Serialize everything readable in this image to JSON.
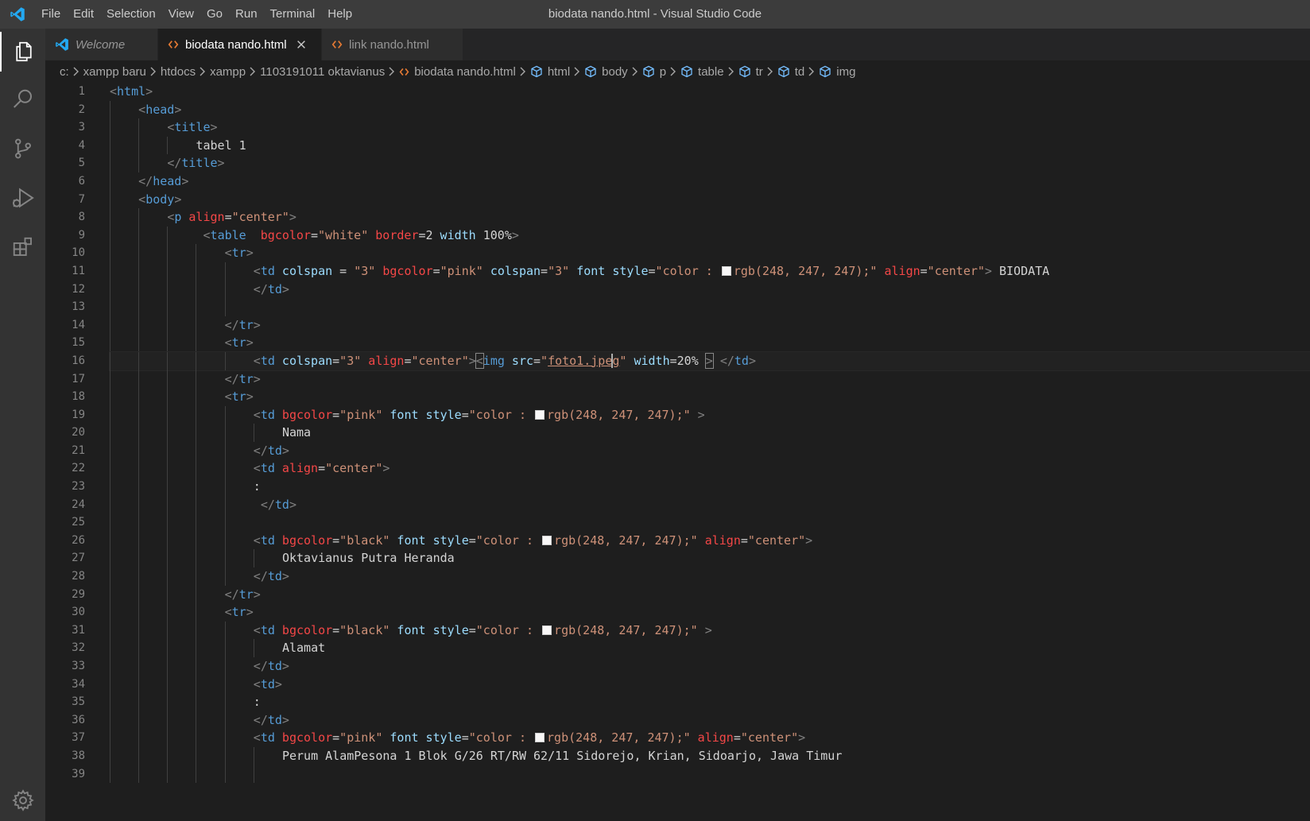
{
  "window": {
    "title": "biodata nando.html - Visual Studio Code",
    "menu": [
      "File",
      "Edit",
      "Selection",
      "View",
      "Go",
      "Run",
      "Terminal",
      "Help"
    ]
  },
  "activity_bar": {
    "items": [
      {
        "name": "explorer-icon",
        "active": true
      },
      {
        "name": "search-icon",
        "active": false
      },
      {
        "name": "source-control-icon",
        "active": false
      },
      {
        "name": "run-debug-icon",
        "active": false
      },
      {
        "name": "extensions-icon",
        "active": false
      }
    ],
    "bottom": {
      "name": "settings-gear-icon"
    }
  },
  "tabs": [
    {
      "label": "Welcome",
      "icon": "vscode-logo-icon",
      "active": false,
      "italic": true
    },
    {
      "label": "biodata nando.html",
      "icon": "html-file-icon",
      "active": true,
      "italic": false
    },
    {
      "label": "link nando.html",
      "icon": "html-file-icon",
      "active": false,
      "italic": false
    }
  ],
  "breadcrumb": [
    "c:",
    "xampp baru",
    "htdocs",
    "xampp",
    "1103191011 oktavianus",
    "biodata nando.html",
    "html",
    "body",
    "p",
    "table",
    "tr",
    "td",
    "img"
  ],
  "editor": {
    "current_line": 16,
    "lines": [
      {
        "n": "1",
        "indent": 0,
        "tokens": [
          [
            "br",
            "<"
          ],
          [
            "tag",
            "html"
          ],
          [
            "br",
            ">"
          ]
        ]
      },
      {
        "n": "2",
        "indent": 1,
        "tokens": [
          [
            "br",
            "<"
          ],
          [
            "tag",
            "head"
          ],
          [
            "br",
            ">"
          ]
        ]
      },
      {
        "n": "3",
        "indent": 2,
        "tokens": [
          [
            "br",
            "<"
          ],
          [
            "tag",
            "title"
          ],
          [
            "br",
            ">"
          ]
        ]
      },
      {
        "n": "4",
        "indent": 3,
        "tokens": [
          [
            "txt",
            "tabel 1"
          ]
        ]
      },
      {
        "n": "5",
        "indent": 2,
        "tokens": [
          [
            "br",
            "</"
          ],
          [
            "tag",
            "title"
          ],
          [
            "br",
            ">"
          ]
        ]
      },
      {
        "n": "6",
        "indent": 1,
        "tokens": [
          [
            "br",
            "</"
          ],
          [
            "tag",
            "head"
          ],
          [
            "br",
            ">"
          ]
        ]
      },
      {
        "n": "7",
        "indent": 1,
        "tokens": [
          [
            "br",
            "<"
          ],
          [
            "tag",
            "body"
          ],
          [
            "br",
            ">"
          ]
        ]
      },
      {
        "n": "8",
        "indent": 2,
        "tokens": [
          [
            "br",
            "<"
          ],
          [
            "tag",
            "p"
          ],
          [
            "txt",
            " "
          ],
          [
            "attrred",
            "align"
          ],
          [
            "txt",
            "="
          ],
          [
            "str",
            "\"center\""
          ],
          [
            "br",
            ">"
          ]
        ]
      },
      {
        "n": "9",
        "indent": 3.25,
        "tokens": [
          [
            "br",
            "<"
          ],
          [
            "tag",
            "table"
          ],
          [
            "txt",
            "  "
          ],
          [
            "attrred",
            "bgcolor"
          ],
          [
            "txt",
            "="
          ],
          [
            "str",
            "\"white\""
          ],
          [
            "txt",
            " "
          ],
          [
            "attrred",
            "border"
          ],
          [
            "txt",
            "=2 "
          ],
          [
            "attr",
            "width"
          ],
          [
            "txt",
            " 100%"
          ],
          [
            "br",
            ">"
          ]
        ]
      },
      {
        "n": "10",
        "indent": 4,
        "tokens": [
          [
            "br",
            "<"
          ],
          [
            "tag",
            "tr"
          ],
          [
            "br",
            ">"
          ]
        ]
      },
      {
        "n": "11",
        "indent": 5,
        "tokens": [
          [
            "br",
            "<"
          ],
          [
            "tag",
            "td"
          ],
          [
            "txt",
            " "
          ],
          [
            "attr",
            "colspan"
          ],
          [
            "txt",
            " = "
          ],
          [
            "str",
            "\"3\""
          ],
          [
            "txt",
            " "
          ],
          [
            "attrred",
            "bgcolor"
          ],
          [
            "txt",
            "="
          ],
          [
            "str",
            "\"pink\""
          ],
          [
            "txt",
            " "
          ],
          [
            "attr",
            "colspan"
          ],
          [
            "txt",
            "="
          ],
          [
            "str",
            "\"3\""
          ],
          [
            "txt",
            " "
          ],
          [
            "attr",
            "font"
          ],
          [
            "txt",
            " "
          ],
          [
            "attr",
            "style"
          ],
          [
            "txt",
            "="
          ],
          [
            "str",
            "\"color : "
          ],
          [
            "swatch",
            ""
          ],
          [
            "str",
            "rgb(248, 247, 247);\""
          ],
          [
            "txt",
            " "
          ],
          [
            "attrred",
            "align"
          ],
          [
            "txt",
            "="
          ],
          [
            "str",
            "\"center\""
          ],
          [
            "br",
            ">"
          ],
          [
            "txt",
            " BIODATA"
          ]
        ]
      },
      {
        "n": "12",
        "indent": 5,
        "tokens": [
          [
            "br",
            "</"
          ],
          [
            "tag",
            "td"
          ],
          [
            "br",
            ">"
          ]
        ]
      },
      {
        "n": "13",
        "indent": 5,
        "tokens": []
      },
      {
        "n": "14",
        "indent": 4,
        "tokens": [
          [
            "br",
            "</"
          ],
          [
            "tag",
            "tr"
          ],
          [
            "br",
            ">"
          ]
        ]
      },
      {
        "n": "15",
        "indent": 4,
        "tokens": [
          [
            "br",
            "<"
          ],
          [
            "tag",
            "tr"
          ],
          [
            "br",
            ">"
          ]
        ]
      },
      {
        "n": "16",
        "indent": 5,
        "tokens": [
          [
            "br",
            "<"
          ],
          [
            "tag",
            "td"
          ],
          [
            "txt",
            " "
          ],
          [
            "attr",
            "colspan"
          ],
          [
            "txt",
            "="
          ],
          [
            "str",
            "\"3\""
          ],
          [
            "txt",
            " "
          ],
          [
            "attrred",
            "align"
          ],
          [
            "txt",
            "="
          ],
          [
            "str",
            "\"center\""
          ],
          [
            "br",
            ">"
          ],
          [
            "brbox",
            "<"
          ],
          [
            "tag",
            "img"
          ],
          [
            "txt",
            " "
          ],
          [
            "attr",
            "src"
          ],
          [
            "txt",
            "="
          ],
          [
            "str",
            "\""
          ],
          [
            "strul",
            "foto1.jpe"
          ],
          [
            "cursor",
            ""
          ],
          [
            "strul",
            "g"
          ],
          [
            "str",
            "\""
          ],
          [
            "txt",
            " "
          ],
          [
            "attr",
            "width"
          ],
          [
            "txt",
            "=20% "
          ],
          [
            "brbox",
            ">"
          ],
          [
            "txt",
            " "
          ],
          [
            "br",
            "</"
          ],
          [
            "tag",
            "td"
          ],
          [
            "br",
            ">"
          ]
        ]
      },
      {
        "n": "17",
        "indent": 4,
        "tokens": [
          [
            "br",
            "</"
          ],
          [
            "tag",
            "tr"
          ],
          [
            "br",
            ">"
          ]
        ]
      },
      {
        "n": "18",
        "indent": 4,
        "tokens": [
          [
            "br",
            "<"
          ],
          [
            "tag",
            "tr"
          ],
          [
            "br",
            ">"
          ]
        ]
      },
      {
        "n": "19",
        "indent": 5,
        "tokens": [
          [
            "br",
            "<"
          ],
          [
            "tag",
            "td"
          ],
          [
            "txt",
            " "
          ],
          [
            "attrred",
            "bgcolor"
          ],
          [
            "txt",
            "="
          ],
          [
            "str",
            "\"pink\""
          ],
          [
            "txt",
            " "
          ],
          [
            "attr",
            "font"
          ],
          [
            "txt",
            " "
          ],
          [
            "attr",
            "style"
          ],
          [
            "txt",
            "="
          ],
          [
            "str",
            "\"color : "
          ],
          [
            "swatch",
            ""
          ],
          [
            "str",
            "rgb(248, 247, 247);\""
          ],
          [
            "txt",
            " "
          ],
          [
            "br",
            ">"
          ]
        ]
      },
      {
        "n": "20",
        "indent": 6,
        "tokens": [
          [
            "txt",
            "Nama"
          ]
        ]
      },
      {
        "n": "21",
        "indent": 5,
        "tokens": [
          [
            "br",
            "</"
          ],
          [
            "tag",
            "td"
          ],
          [
            "br",
            ">"
          ]
        ]
      },
      {
        "n": "22",
        "indent": 5,
        "tokens": [
          [
            "br",
            "<"
          ],
          [
            "tag",
            "td"
          ],
          [
            "txt",
            " "
          ],
          [
            "attrred",
            "align"
          ],
          [
            "txt",
            "="
          ],
          [
            "str",
            "\"center\""
          ],
          [
            "br",
            ">"
          ]
        ]
      },
      {
        "n": "23",
        "indent": 5,
        "tokens": [
          [
            "txt",
            ":"
          ]
        ]
      },
      {
        "n": "24",
        "indent": 5,
        "tokens": [
          [
            "txt",
            " "
          ],
          [
            "br",
            "</"
          ],
          [
            "tag",
            "td"
          ],
          [
            "br",
            ">"
          ]
        ]
      },
      {
        "n": "25",
        "indent": 5,
        "tokens": []
      },
      {
        "n": "26",
        "indent": 5,
        "tokens": [
          [
            "br",
            "<"
          ],
          [
            "tag",
            "td"
          ],
          [
            "txt",
            " "
          ],
          [
            "attrred",
            "bgcolor"
          ],
          [
            "txt",
            "="
          ],
          [
            "str",
            "\"black\""
          ],
          [
            "txt",
            " "
          ],
          [
            "attr",
            "font"
          ],
          [
            "txt",
            " "
          ],
          [
            "attr",
            "style"
          ],
          [
            "txt",
            "="
          ],
          [
            "str",
            "\"color : "
          ],
          [
            "swatch",
            ""
          ],
          [
            "str",
            "rgb(248, 247, 247);\""
          ],
          [
            "txt",
            " "
          ],
          [
            "attrred",
            "align"
          ],
          [
            "txt",
            "="
          ],
          [
            "str",
            "\"center\""
          ],
          [
            "br",
            ">"
          ]
        ]
      },
      {
        "n": "27",
        "indent": 6,
        "tokens": [
          [
            "txt",
            "Oktavianus Putra Heranda"
          ]
        ]
      },
      {
        "n": "28",
        "indent": 5,
        "tokens": [
          [
            "br",
            "</"
          ],
          [
            "tag",
            "td"
          ],
          [
            "br",
            ">"
          ]
        ]
      },
      {
        "n": "29",
        "indent": 4,
        "tokens": [
          [
            "br",
            "</"
          ],
          [
            "tag",
            "tr"
          ],
          [
            "br",
            ">"
          ]
        ]
      },
      {
        "n": "30",
        "indent": 4,
        "tokens": [
          [
            "br",
            "<"
          ],
          [
            "tag",
            "tr"
          ],
          [
            "br",
            ">"
          ]
        ]
      },
      {
        "n": "31",
        "indent": 5,
        "tokens": [
          [
            "br",
            "<"
          ],
          [
            "tag",
            "td"
          ],
          [
            "txt",
            " "
          ],
          [
            "attrred",
            "bgcolor"
          ],
          [
            "txt",
            "="
          ],
          [
            "str",
            "\"black\""
          ],
          [
            "txt",
            " "
          ],
          [
            "attr",
            "font"
          ],
          [
            "txt",
            " "
          ],
          [
            "attr",
            "style"
          ],
          [
            "txt",
            "="
          ],
          [
            "str",
            "\"color : "
          ],
          [
            "swatch",
            ""
          ],
          [
            "str",
            "rgb(248, 247, 247);\""
          ],
          [
            "txt",
            " "
          ],
          [
            "br",
            ">"
          ]
        ]
      },
      {
        "n": "32",
        "indent": 6,
        "tokens": [
          [
            "txt",
            "Alamat"
          ]
        ]
      },
      {
        "n": "33",
        "indent": 5,
        "tokens": [
          [
            "br",
            "</"
          ],
          [
            "tag",
            "td"
          ],
          [
            "br",
            ">"
          ]
        ]
      },
      {
        "n": "34",
        "indent": 5,
        "tokens": [
          [
            "br",
            "<"
          ],
          [
            "tag",
            "td"
          ],
          [
            "br",
            ">"
          ]
        ]
      },
      {
        "n": "35",
        "indent": 5,
        "tokens": [
          [
            "txt",
            ":"
          ]
        ]
      },
      {
        "n": "36",
        "indent": 5,
        "tokens": [
          [
            "br",
            "</"
          ],
          [
            "tag",
            "td"
          ],
          [
            "br",
            ">"
          ]
        ]
      },
      {
        "n": "37",
        "indent": 5,
        "tokens": [
          [
            "br",
            "<"
          ],
          [
            "tag",
            "td"
          ],
          [
            "txt",
            " "
          ],
          [
            "attrred",
            "bgcolor"
          ],
          [
            "txt",
            "="
          ],
          [
            "str",
            "\"pink\""
          ],
          [
            "txt",
            " "
          ],
          [
            "attr",
            "font"
          ],
          [
            "txt",
            " "
          ],
          [
            "attr",
            "style"
          ],
          [
            "txt",
            "="
          ],
          [
            "str",
            "\"color : "
          ],
          [
            "swatch",
            ""
          ],
          [
            "str",
            "rgb(248, 247, 247);\""
          ],
          [
            "txt",
            " "
          ],
          [
            "attrred",
            "align"
          ],
          [
            "txt",
            "="
          ],
          [
            "str",
            "\"center\""
          ],
          [
            "br",
            ">"
          ]
        ]
      },
      {
        "n": "38",
        "indent": 6,
        "tokens": [
          [
            "txt",
            "Perum AlamPesona 1 Blok G/26 RT/RW 62/11 Sidorejo, Krian, Sidoarjo, Jawa Timur"
          ]
        ]
      },
      {
        "n": "39",
        "indent": 6,
        "tokens": []
      }
    ]
  },
  "colors": {
    "titlebar": "#3c3c3c",
    "activitybar": "#333333",
    "editor_bg": "#1e1e1e",
    "tag": "#569cd6",
    "attr": "#9cdcfe",
    "attr_red": "#f44747",
    "string": "#ce9178",
    "text": "#d4d4d4",
    "vscode_blue": "#23a9f2"
  }
}
